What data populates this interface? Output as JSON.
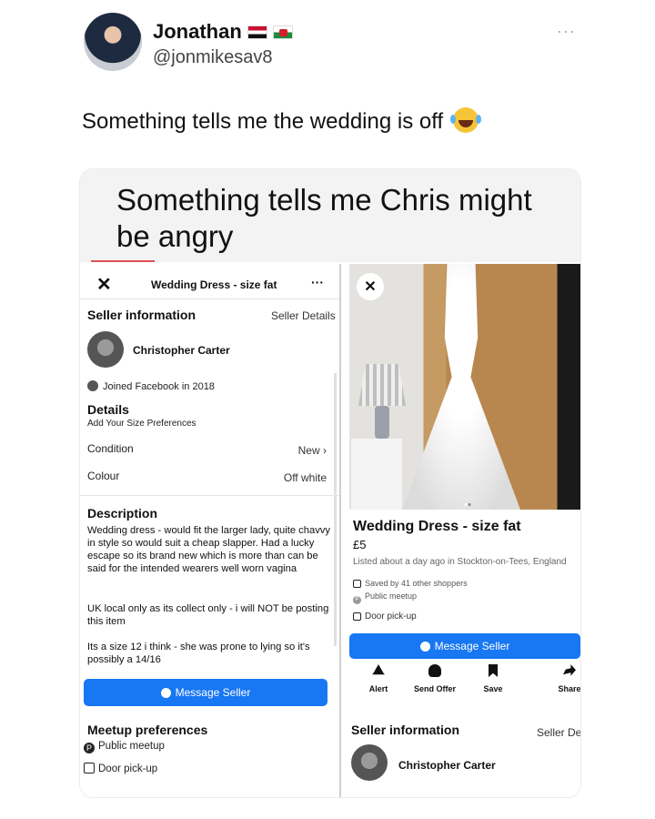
{
  "tweet": {
    "name": "Jonathan",
    "handle": "@jonmikesav8",
    "more": "···",
    "text": "Something tells me the wedding is off"
  },
  "caption": "Something tells me Chris might be angry",
  "left_screen": {
    "close": "✕",
    "title": "Wedding Dress - size fat",
    "menu": "···",
    "seller_heading": "Seller information",
    "seller_details_link": "Seller Details",
    "seller_name": "Christopher Carter",
    "joined": "Joined Facebook in 2018",
    "details_heading": "Details",
    "size_prefs": "Add Your Size Preferences",
    "condition_label": "Condition",
    "condition_value": "New",
    "colour_label": "Colour",
    "colour_value": "Off white",
    "description_heading": "Description",
    "desc_p1": "Wedding dress - would fit the larger lady, quite chavvy in style so would suit a cheap slapper. Had a lucky escape so its brand new which is more than can be said for the intended wearers well worn vagina",
    "desc_p2": "UK local only as its collect only - i will NOT be posting this item",
    "desc_p3": "Its a size 12 i think - she was prone to lying so it's possibly a 14/16",
    "message_button": "Message Seller",
    "meetup_heading": "Meetup preferences",
    "meetup_public": "Public meetup",
    "meetup_door": "Door pick-up"
  },
  "right_screen": {
    "close": "✕",
    "title": "Wedding Dress - size fat",
    "price": "£5",
    "listed": "Listed about a day ago in Stockton-on-Tees, England",
    "saved": "Saved by 41 other shoppers",
    "public_meetup": "Public meetup",
    "door_pickup": "Door pick-up",
    "message_button": "Message Seller",
    "actions": [
      "Alert",
      "Send Offer",
      "Save",
      "Share"
    ],
    "seller_heading": "Seller information",
    "seller_details_link": "Seller Details",
    "seller_name": "Christopher Carter"
  },
  "colors": {
    "facebook_blue": "#1877f2"
  },
  "icons": [
    "emoji-laughing-icon",
    "egypt-flag-icon",
    "wales-flag-icon",
    "close-icon",
    "facebook-icon",
    "message-icon",
    "alert-bell-icon",
    "send-offer-icon",
    "save-bookmark-icon",
    "share-icon"
  ]
}
